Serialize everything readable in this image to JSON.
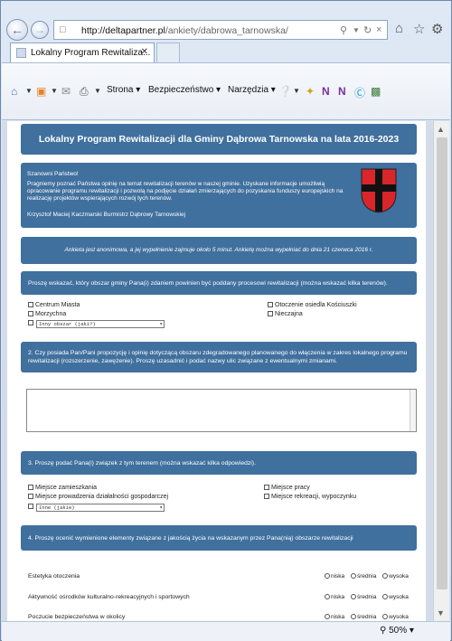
{
  "browser": {
    "url_host": "http://deltapartner.pl",
    "url_path": "/ankiety/dabrowa_tarnowska/",
    "tab_title": "Lokalny Program Rewitaliza...",
    "zoom": "50%"
  },
  "menu": {
    "page": "Strona",
    "safety": "Bezpieczeństwo",
    "tools": "Narzędzia"
  },
  "survey": {
    "title": "Lokalny Program Rewitalizacji dla Gminy Dąbrowa Tarnowska na lata 2016-2023",
    "greeting": "Szanowni Państwo!",
    "intro": "Pragniemy poznać Państwa opinię na temat rewitalizacji terenów w naszej gminie. Uzyskane informacje umożliwią opracowanie programu rewitalizacji i pozwolą na podjęcie działań zmierzających do pozyskania funduszy europejskich na realizację projektów wspierających rozwój tych terenów.",
    "signature": "Krzysztof Maciej Kaczmarski Burmistrz Dąbrowy Tarnowskiej",
    "notice": "Ankieta jest anonimowa, a jej wypełnienie zajmuje około 5 minut. Ankietę można wypełniać do dnia 21 czerwca 2016 r.",
    "q1": {
      "text": "Proszę wskazać, który obszar gminy Pana(i) zdaniem powinien być poddany procesowi rewitalizacji (można wskazać kilka terenów).",
      "options_left": [
        "Centrum Miasta",
        "Morzychna"
      ],
      "options_right": [
        "Otoczenie osiedla Kościuszki",
        "Nieczajna"
      ],
      "other_placeholder": "Inny obszar (jaki?)"
    },
    "q2": {
      "text": "2. Czy posiada Pan/Pani propozycję i opinię dotyczącą obszaru zdegradowanego planowanego do włączenia w zakres lokalnego programu rewitalizacji (rozszerzenie, zawężenie). Proszę uzasadnić i podać nazwy ulic związane z ewentualnymi zmianami."
    },
    "q3": {
      "text": "3. Proszę podać Pana(i) związek z tym terenem (można wskazać kilka odpowiedzi).",
      "options_left": [
        "Miejsce zamieszkania",
        "Miejsce prowadzenia działalności gospodarczej"
      ],
      "options_right": [
        "Miejsce pracy",
        "Miejsce rekreacji, wypoczynku"
      ],
      "other_placeholder": "Inne (jakie)"
    },
    "q4": {
      "text": "4. Proszę ocenić wymienione elementy związane z jakością życia na wskazanym przez Pana(nią) obszarze rewitalizacji",
      "scale": [
        "niska",
        "średnia",
        "wysoka"
      ],
      "rows": [
        "Estetyka otoczenia",
        "Aktywność ośrodków kulturalno-rekreacyjnych i sportowych",
        "Poczucie bezpieczeństwa w okolicy"
      ]
    }
  }
}
